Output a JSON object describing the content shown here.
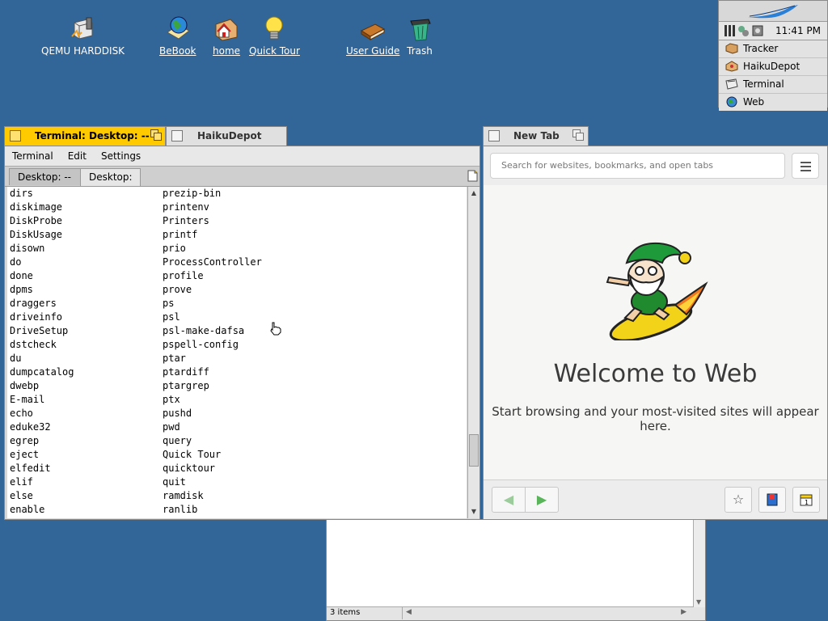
{
  "desktop": {
    "icons": [
      {
        "label": "QEMU HARDDISK"
      },
      {
        "label": "BeBook"
      },
      {
        "label": "home"
      },
      {
        "label": "Quick Tour"
      },
      {
        "label": "User Guide"
      },
      {
        "label": "Trash"
      }
    ]
  },
  "deskbar": {
    "clock": "11:41 PM",
    "items": [
      {
        "label": "Tracker",
        "icon": "tracker-icon"
      },
      {
        "label": "HaikuDepot",
        "icon": "haikudepot-icon"
      },
      {
        "label": "Terminal",
        "icon": "terminal-icon"
      },
      {
        "label": "Web",
        "icon": "web-icon"
      }
    ]
  },
  "terminal_window": {
    "title": "Terminal: Desktop: --",
    "stacked_tab": "HaikuDepot",
    "menu": [
      "Terminal",
      "Edit",
      "Settings"
    ],
    "tabs": [
      "Desktop: --",
      "Desktop: --"
    ],
    "lines": [
      [
        "dirs",
        "prezip-bin"
      ],
      [
        "diskimage",
        "printenv"
      ],
      [
        "DiskProbe",
        "Printers"
      ],
      [
        "DiskUsage",
        "printf"
      ],
      [
        "disown",
        "prio"
      ],
      [
        "do",
        "ProcessController"
      ],
      [
        "done",
        "profile"
      ],
      [
        "dpms",
        "prove"
      ],
      [
        "draggers",
        "ps"
      ],
      [
        "driveinfo",
        "psl"
      ],
      [
        "DriveSetup",
        "psl-make-dafsa"
      ],
      [
        "dstcheck",
        "pspell-config"
      ],
      [
        "du",
        "ptar"
      ],
      [
        "dumpcatalog",
        "ptardiff"
      ],
      [
        "dwebp",
        "ptargrep"
      ],
      [
        "E-mail",
        "ptx"
      ],
      [
        "echo",
        "pushd"
      ],
      [
        "eduke32",
        "pwd"
      ],
      [
        "egrep",
        "query"
      ],
      [
        "eject",
        "Quick Tour"
      ],
      [
        "elfedit",
        "quicktour"
      ],
      [
        "elif",
        "quit"
      ],
      [
        "else",
        "ramdisk"
      ],
      [
        "enable",
        "ranlib"
      ]
    ]
  },
  "web_window": {
    "title": "New Tab",
    "search_placeholder": "Search for websites, bookmarks, and open tabs",
    "welcome_title": "Welcome to Web",
    "welcome_text": "Start browsing and your most-visited sites will appear here."
  },
  "tracker_window": {
    "status": "3 items"
  },
  "colors": {
    "desktop": "#336698",
    "active_tab": "#ffcb00",
    "inactive_tab": "#e0e0e0"
  }
}
